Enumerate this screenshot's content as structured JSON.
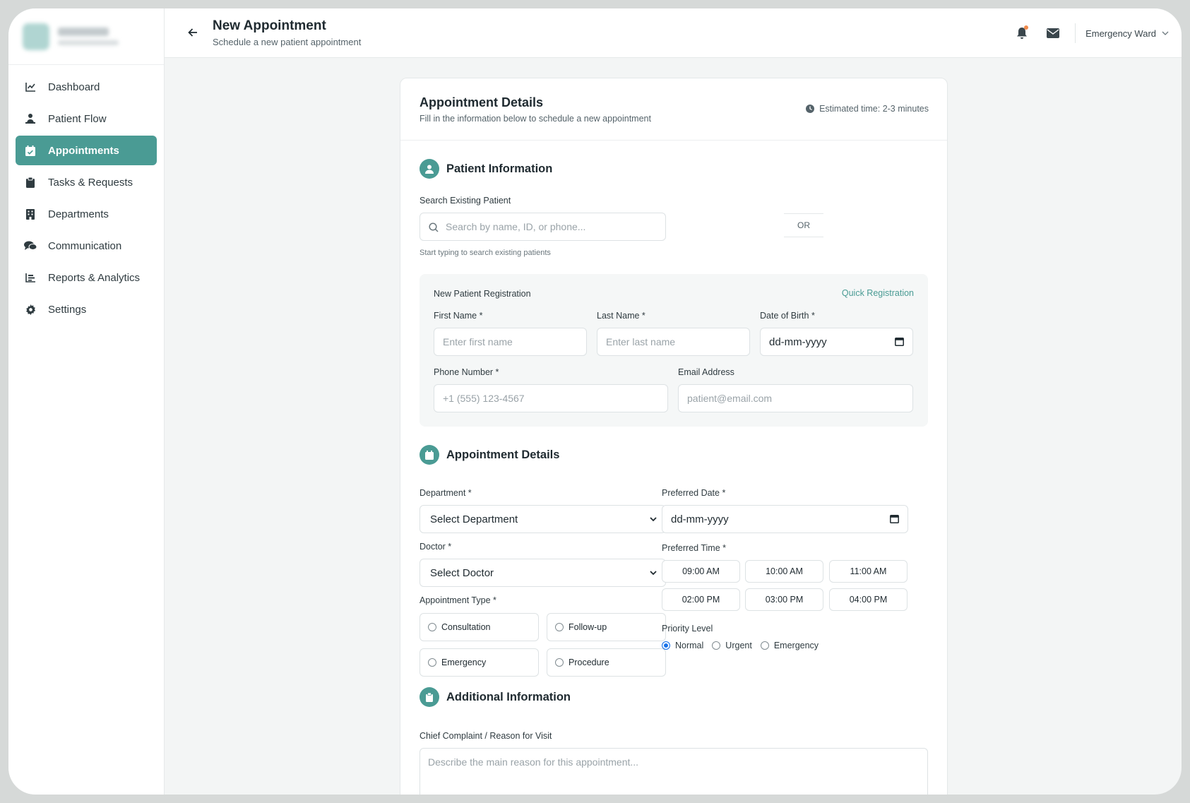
{
  "sidebar": {
    "items": [
      {
        "label": "Dashboard",
        "icon": "chart-line-icon"
      },
      {
        "label": "Patient Flow",
        "icon": "user-flow-icon"
      },
      {
        "label": "Appointments",
        "icon": "calendar-check-icon",
        "active": true
      },
      {
        "label": "Tasks & Requests",
        "icon": "clipboard-icon"
      },
      {
        "label": "Departments",
        "icon": "building-icon"
      },
      {
        "label": "Communication",
        "icon": "chat-icon"
      },
      {
        "label": "Reports & Analytics",
        "icon": "bar-chart-icon"
      },
      {
        "label": "Settings",
        "icon": "gear-icon"
      }
    ]
  },
  "header": {
    "title": "New Appointment",
    "subtitle": "Schedule a new patient appointment",
    "ward": "Emergency Ward"
  },
  "card": {
    "title": "Appointment Details",
    "subtitle": "Fill in the information below to schedule a new appointment",
    "estimate": "Estimated time: 2-3 minutes"
  },
  "patient": {
    "section_title": "Patient Information",
    "search_label": "Search Existing Patient",
    "search_placeholder": "Search by name, ID, or phone...",
    "search_hint": "Start typing to search existing patients",
    "or_label": "OR",
    "registration": {
      "title": "New Patient Registration",
      "quick_link": "Quick Registration",
      "first_name_label": "First Name *",
      "first_name_placeholder": "Enter first name",
      "last_name_label": "Last Name *",
      "last_name_placeholder": "Enter last name",
      "dob_label": "Date of Birth *",
      "dob_value": "dd-mm-yyyy",
      "phone_label": "Phone Number *",
      "phone_placeholder": "+1 (555) 123-4567",
      "email_label": "Email Address",
      "email_placeholder": "patient@email.com"
    }
  },
  "appointment": {
    "section_title": "Appointment Details",
    "department_label": "Department *",
    "department_value": "Select Department",
    "doctor_label": "Doctor *",
    "doctor_value": "Select Doctor",
    "type_label": "Appointment Type *",
    "types": [
      "Consultation",
      "Follow-up",
      "Emergency",
      "Procedure"
    ],
    "date_label": "Preferred Date *",
    "date_value": "dd-mm-yyyy",
    "time_label": "Preferred Time *",
    "times": [
      "09:00 AM",
      "10:00 AM",
      "11:00 AM",
      "02:00 PM",
      "03:00 PM",
      "04:00 PM"
    ],
    "priority_label": "Priority Level",
    "priorities": [
      "Normal",
      "Urgent",
      "Emergency"
    ],
    "priority_selected": "Normal"
  },
  "additional": {
    "section_title": "Additional Information",
    "complaint_label": "Chief Complaint / Reason for Visit",
    "complaint_placeholder": "Describe the main reason for this appointment..."
  },
  "colors": {
    "accent": "#4a9b94",
    "notification_dot": "#f08a4b",
    "radio_selected": "#1a73e8"
  }
}
